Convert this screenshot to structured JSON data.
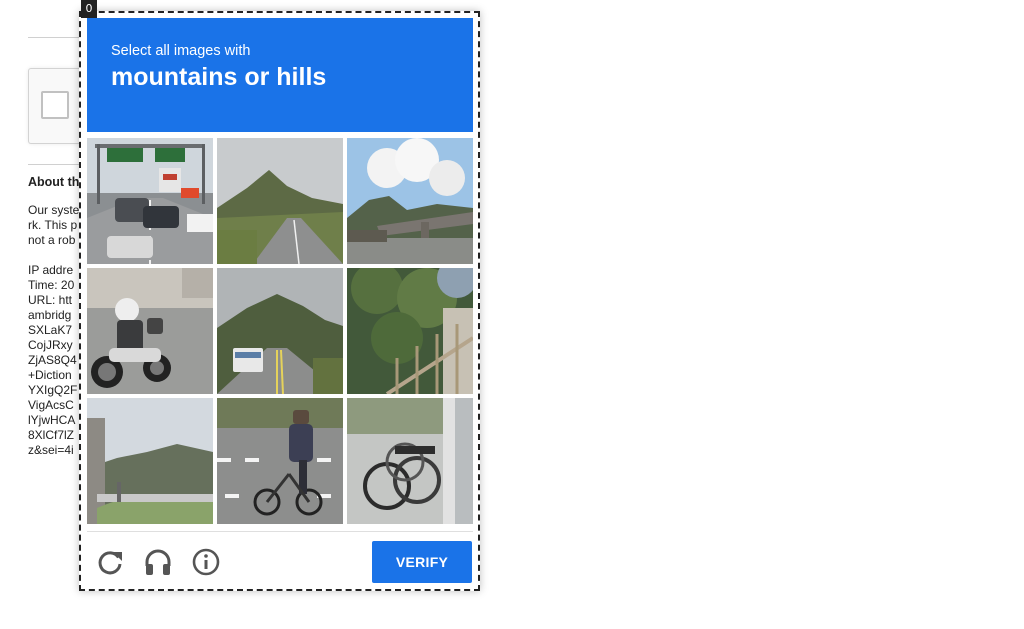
{
  "background": {
    "about_heading": "About th",
    "lines": [
      "Our syste",
      "rk. This p",
      "not a rob",
      "",
      "IP addre",
      "Time: 20",
      "URL: htt",
      "ambridg",
      "SXLaK7",
      "CojJRxy",
      "ZjAS8Q4",
      "+Diction",
      "YXIgQ2F",
      "VigAcsC",
      "lYjwHCA",
      "8XlCf7lZ",
      "z&sei=4i"
    ]
  },
  "challenge": {
    "badge": "0",
    "prompt": "Select all images with",
    "target": "mountains or hills",
    "tiles": [
      {
        "scene": "highway traffic with overhead sign gantry and cars"
      },
      {
        "scene": "road through green valley with mountain"
      },
      {
        "scene": "bridge over road with hills and clouds"
      },
      {
        "scene": "motorcyclist in helmet on road"
      },
      {
        "scene": "bus on highway with green hills"
      },
      {
        "scene": "metal railing with trees"
      },
      {
        "scene": "building with mountain behind"
      },
      {
        "scene": "cyclist crossing road"
      },
      {
        "scene": "parked bicycles next to wall"
      }
    ],
    "verify_label": "VERIFY",
    "icons": [
      "reload-icon",
      "audio-headphones-icon",
      "info-icon"
    ]
  }
}
